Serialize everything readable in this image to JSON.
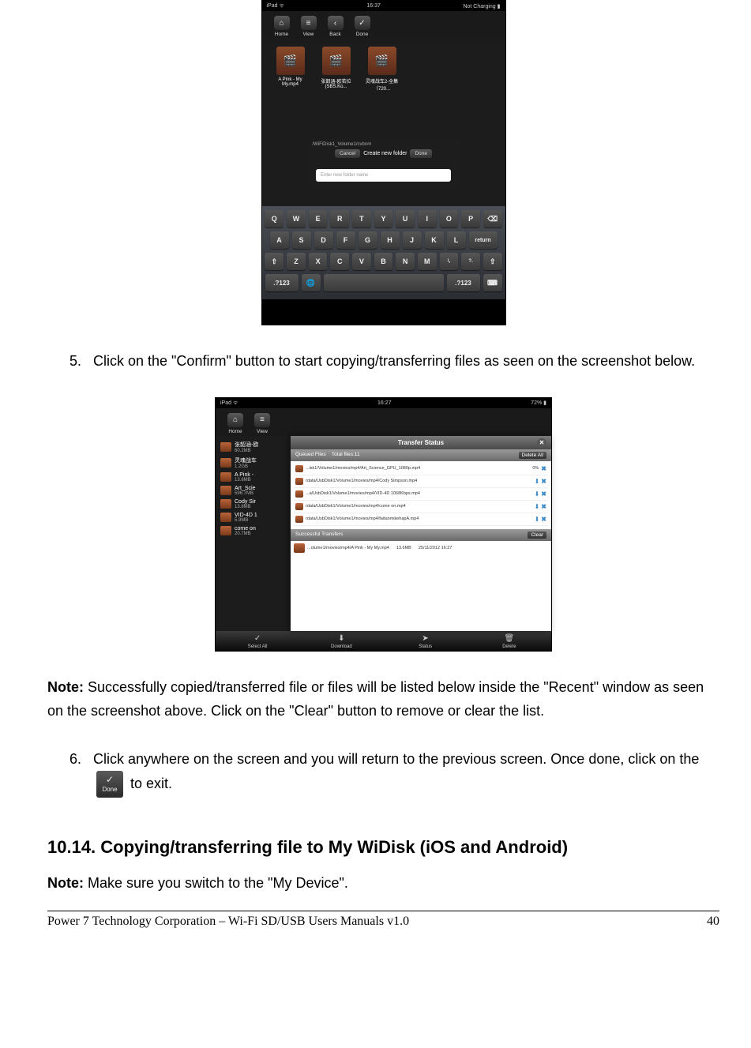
{
  "shot1": {
    "status": {
      "left": "iPad ᯤ",
      "center": "16:37",
      "right": "Not Charging ▮"
    },
    "toolbar": [
      {
        "icon": "⌂",
        "label": "Home"
      },
      {
        "icon": "≡",
        "label": "View"
      },
      {
        "icon": "‹",
        "label": "Back"
      },
      {
        "icon": "✓",
        "label": "Done"
      }
    ],
    "thumbs": [
      {
        "name": "A Pink - My My.mp4"
      },
      {
        "name": "张韶涵-欧若拉(SBS.Ko..."
      },
      {
        "name": "灵魂战车2-全集（720..."
      }
    ],
    "dialog": {
      "path": "/WiFiDisk1_Volume1/cvbnm",
      "cancel": "Cancel",
      "title": "Create new folder",
      "done": "Done",
      "placeholder": "Enter new folder name"
    },
    "keyboard": {
      "row1": [
        "Q",
        "W",
        "E",
        "R",
        "T",
        "Y",
        "U",
        "I",
        "O",
        "P",
        "⌫"
      ],
      "row2": [
        "A",
        "S",
        "D",
        "F",
        "G",
        "H",
        "J",
        "K",
        "L",
        "return"
      ],
      "row3": [
        "⇧",
        "Z",
        "X",
        "C",
        "V",
        "B",
        "N",
        "M",
        "!",
        ",",
        "?",
        ".",
        "⇧"
      ],
      "row4": [
        ".?123",
        "🌐",
        "",
        "",
        ".?123",
        "⌨"
      ]
    }
  },
  "step5_num": "5.",
  "step5": "Click on the \"Confirm\" button to start copying/transferring files as seen on the screenshot below.",
  "shot2": {
    "status": {
      "left": "iPad ᯤ",
      "center": "16:27",
      "right": "72% ▮"
    },
    "toolbar": [
      {
        "icon": "⌂",
        "label": "Home"
      },
      {
        "icon": "≡",
        "label": "View"
      }
    ],
    "files": [
      {
        "name": "张韶涵-欧",
        "size": "60.2MB"
      },
      {
        "name": "灵魂战车",
        "size": "1.2GB"
      },
      {
        "name": "A Pink -",
        "size": "13.6MB"
      },
      {
        "name": "Art_Scie",
        "size": "596.7MB"
      },
      {
        "name": "Cody Sir",
        "size": "13.8MB"
      },
      {
        "name": "VID-4D 1",
        "size": "5.9MB"
      },
      {
        "name": "come on",
        "size": "20.7MB"
      }
    ],
    "panel": {
      "title": "Transfer Status",
      "queued_label": "Queued Files",
      "total_label": "Total files:11",
      "delete_all": "Delete All",
      "queue": [
        {
          "path": "...isk1/Volume1/movies/mp4/Art_Science_GPU_1080p.mp4",
          "pct": "0%"
        },
        {
          "path": "rdata/UsbDisk1/Volume1/movies/mp4/Cody Simpson.mp4"
        },
        {
          "path": "...a/UsbDisk1/Volume1/movies/mp4/VID-4D 1068Kbps.mp4"
        },
        {
          "path": "rdata/UsbDisk1/Volume1/movies/mp4/come on.mp4"
        },
        {
          "path": "rdata/UsbDisk1/Volume1/movies/mp4/faitanmikehapA.mp4"
        }
      ],
      "success_label": "Successful Transfers",
      "clear": "Clear",
      "success": [
        {
          "path": "...olume1/movies/mp4/A Pink - My My.mp4",
          "size": "13.6MB",
          "date": "25/11/2012 16:27"
        }
      ]
    },
    "bottombar": [
      {
        "icon": "✓",
        "label": "Select All"
      },
      {
        "icon": "⬇",
        "label": "Download"
      },
      {
        "icon": "➤",
        "label": "Status"
      },
      {
        "icon": "🗑",
        "label": "Delete"
      }
    ]
  },
  "note1_prefix": "Note:",
  "note1": " Successfully copied/transferred file or files will be listed below inside the \"Recent\" window as seen on the screenshot above.   Click on the \"Clear\" button to remove or clear the list.",
  "step6_num": "6.",
  "step6_a": "Click anywhere on the screen and you will return to the previous screen.   Once done, click on the ",
  "done_label": "Done",
  "step6_b": " to exit.",
  "section_heading": "10.14. Copying/transferring file to My WiDisk (iOS and Android)",
  "note2_prefix": "Note:",
  "note2": " Make sure you switch to the \"My Device\".",
  "footer_left": "Power 7 Technology Corporation – Wi-Fi SD/USB Users Manuals v1.0",
  "footer_right": "40"
}
